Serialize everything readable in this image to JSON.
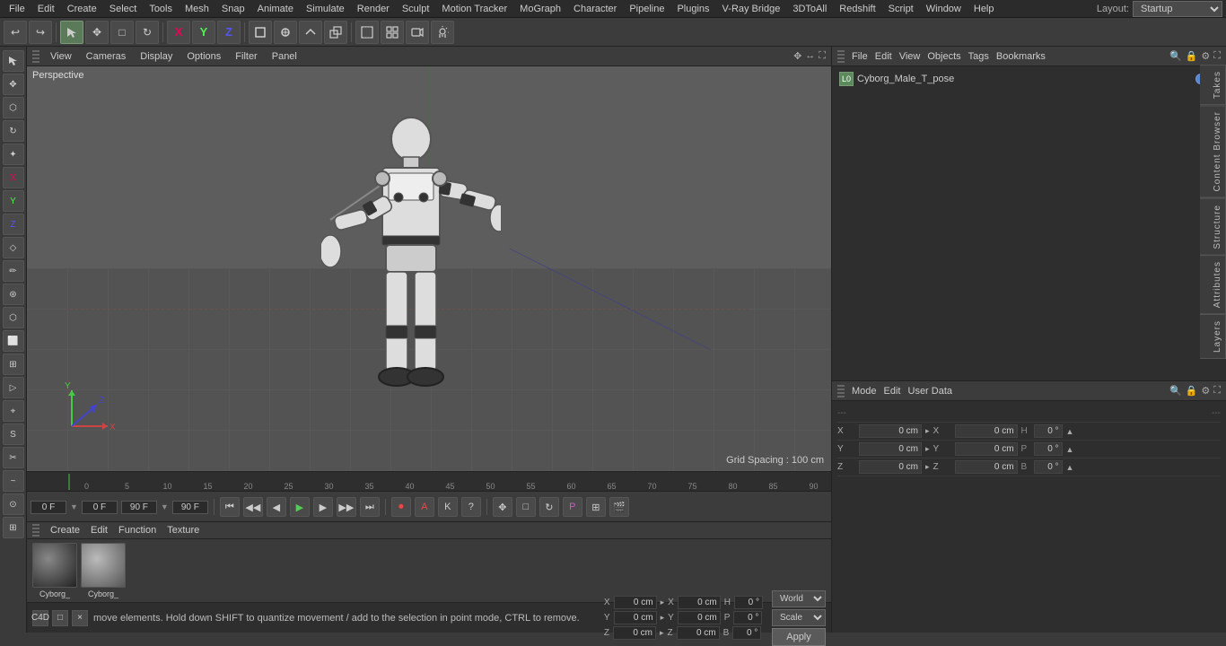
{
  "menuBar": {
    "items": [
      "File",
      "Edit",
      "Create",
      "Select",
      "Tools",
      "Mesh",
      "Snap",
      "Animate",
      "Simulate",
      "Render",
      "Sculpt",
      "Motion Tracker",
      "MoGraph",
      "Character",
      "Pipeline",
      "Plugins",
      "V-Ray Bridge",
      "3DToAll",
      "Redshift",
      "Script",
      "Window",
      "Help"
    ],
    "layoutLabel": "Layout:",
    "layoutValue": "Startup"
  },
  "toolbar": {
    "undoIcon": "↩",
    "redoIcon": "↪",
    "moveIcon": "✥",
    "scaleIcon": "⤡",
    "rotateIcon": "↻",
    "xAxisLabel": "X",
    "yAxisLabel": "Y",
    "zAxisLabel": "Z",
    "cubeIcon": "□",
    "penIcon": "✏",
    "loopIcon": "⟳",
    "extrudeIcon": "⬡",
    "brushIcon": "⬜",
    "gridIcon": "⊞",
    "cameraIcon": "📷",
    "lightIcon": "💡"
  },
  "viewport": {
    "label": "Perspective",
    "gridSpacing": "Grid Spacing : 100 cm",
    "menus": [
      "View",
      "Cameras",
      "Display",
      "Options",
      "Filter",
      "Panel"
    ]
  },
  "timeline": {
    "marks": [
      "0",
      "5",
      "10",
      "15",
      "20",
      "25",
      "30",
      "35",
      "40",
      "45",
      "50",
      "55",
      "60",
      "65",
      "70",
      "75",
      "80",
      "85",
      "90"
    ],
    "currentFrame": "0 F",
    "startFrame": "0 F",
    "endFrame": "90 F",
    "maxFrame": "90 F",
    "frameIndicator": "0 F"
  },
  "timelineControls": {
    "toStart": "⏮",
    "prevKey": "◀◀",
    "prevFrame": "◀",
    "play": "▶",
    "nextFrame": "▶",
    "nextKey": "▶▶",
    "toEnd": "⏭",
    "record": "⏺",
    "autoKey": "A",
    "keyframe": "K",
    "help": "?",
    "btn1": "✥",
    "btn2": "□",
    "btn3": "↻",
    "btn4": "P",
    "btn5": "⊞",
    "btn6": "🎬"
  },
  "materialArea": {
    "menus": [
      "Create",
      "Edit",
      "Function",
      "Texture"
    ],
    "materials": [
      {
        "name": "Cyborg_",
        "color": "#555"
      },
      {
        "name": "Cyborg_",
        "color": "#888"
      }
    ]
  },
  "statusBar": {
    "text": "move elements. Hold down SHIFT to quantize movement / add to the selection in point mode, CTRL to remove.",
    "worldLabel": "World",
    "scaleLabel": "Scale",
    "applyLabel": "Apply"
  },
  "coordinates": {
    "rows": [
      {
        "axis": "X",
        "value1Label": "X",
        "value1": "0 cm",
        "value2Label": "H",
        "value2": "0 °"
      },
      {
        "axis": "Y",
        "value1Label": "Y",
        "value1": "0 cm",
        "value2Label": "P",
        "value2": "0 °"
      },
      {
        "axis": "Z",
        "value1Label": "Z",
        "value1": "0 cm",
        "value2Label": "B",
        "value2": "0 °"
      }
    ]
  },
  "objectManager": {
    "menus": [
      "File",
      "Edit",
      "View",
      "Objects",
      "Tags",
      "Bookmarks"
    ],
    "object": {
      "name": "Cyborg_Male_T_pose",
      "iconText": "L0",
      "dot1Color": "#5588cc",
      "dot2Color": "#cc5555"
    }
  },
  "attributesPanel": {
    "menus": [
      "Mode",
      "Edit",
      "User Data"
    ],
    "coordDashRow": "---",
    "coordDash2": "---",
    "rows": [
      {
        "axis": "X",
        "pos": "0 cm",
        "arrow": "▸",
        "posLabel": "X",
        "posVal": "0 cm",
        "angLabel": "H",
        "ang": "0 °"
      },
      {
        "axis": "Y",
        "pos": "0 cm",
        "arrow": "▸",
        "posLabel": "Y",
        "posVal": "0 cm",
        "angLabel": "P",
        "ang": "0 °"
      },
      {
        "axis": "Z",
        "pos": "0 cm",
        "arrow": "▸",
        "posLabel": "Z",
        "posVal": "0 cm",
        "angLabel": "B",
        "ang": "0 °"
      }
    ]
  },
  "sideTabs": {
    "tab1": "Takes",
    "tab2": "Content Browser",
    "tab3": "Structure",
    "tab4": "Attributes",
    "tab5": "Layers"
  },
  "leftTools": {
    "tools": [
      "↖",
      "✥",
      "□",
      "↻",
      "✦",
      "X",
      "Y",
      "Z",
      "◇",
      "✏",
      "⊛",
      "⬡",
      "⬜",
      "⊞",
      "▷",
      "⌖",
      "S",
      "✂",
      "~",
      "⊙",
      "⊞"
    ]
  }
}
